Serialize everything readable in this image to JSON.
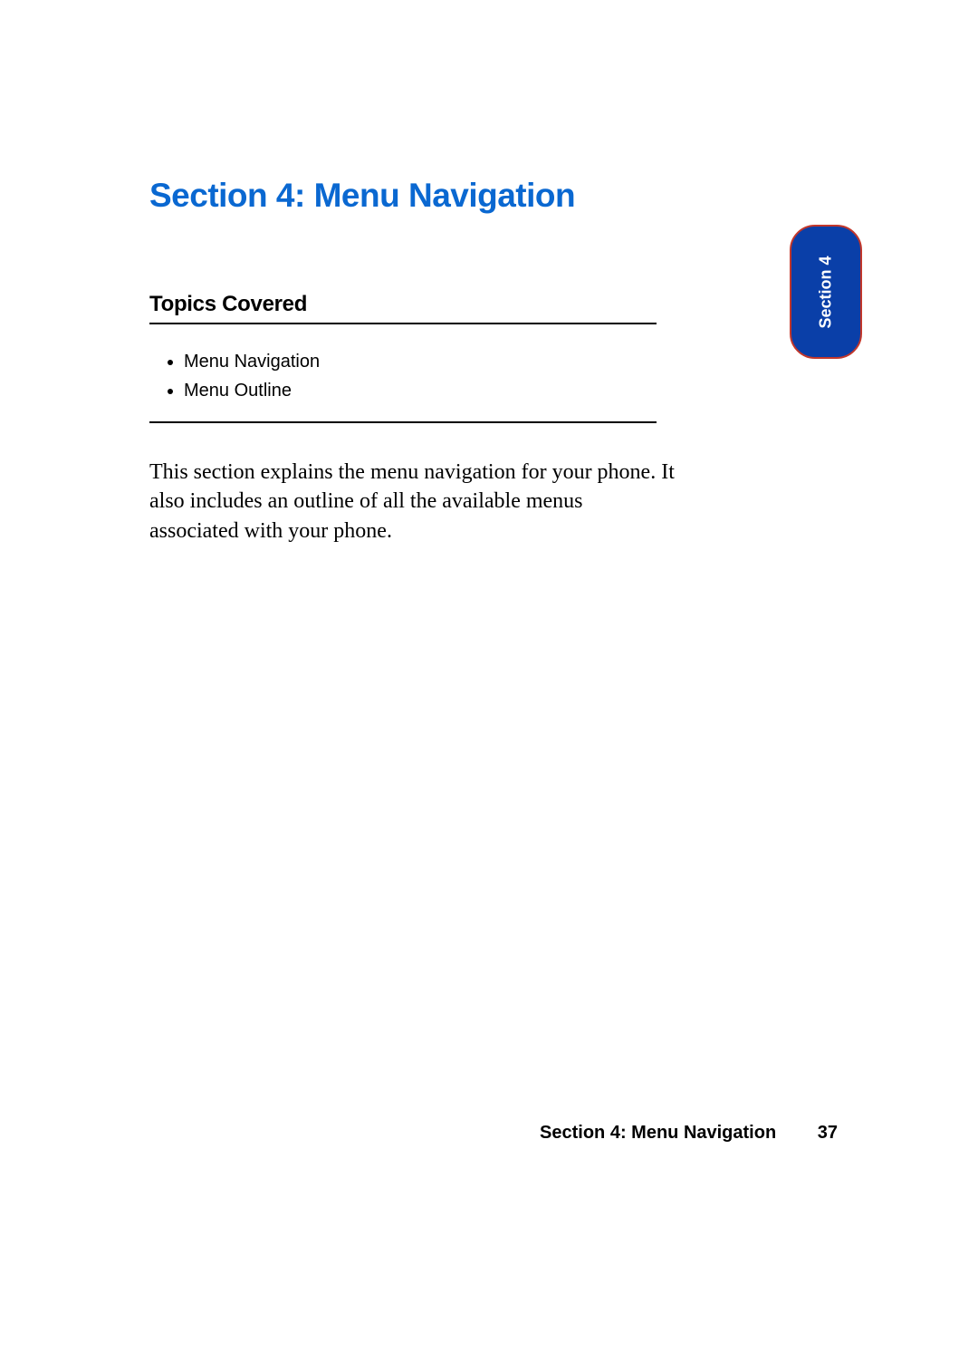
{
  "title": "Section 4: Menu Navigation",
  "topics": {
    "heading": "Topics Covered",
    "items": [
      "Menu Navigation",
      "Menu Outline"
    ]
  },
  "intro": "This section explains the menu navigation for your phone. It also includes an outline of all the available menus associated with your phone.",
  "side_tab": "Section 4",
  "footer": {
    "label": "Section 4: Menu Navigation",
    "page": "37"
  }
}
